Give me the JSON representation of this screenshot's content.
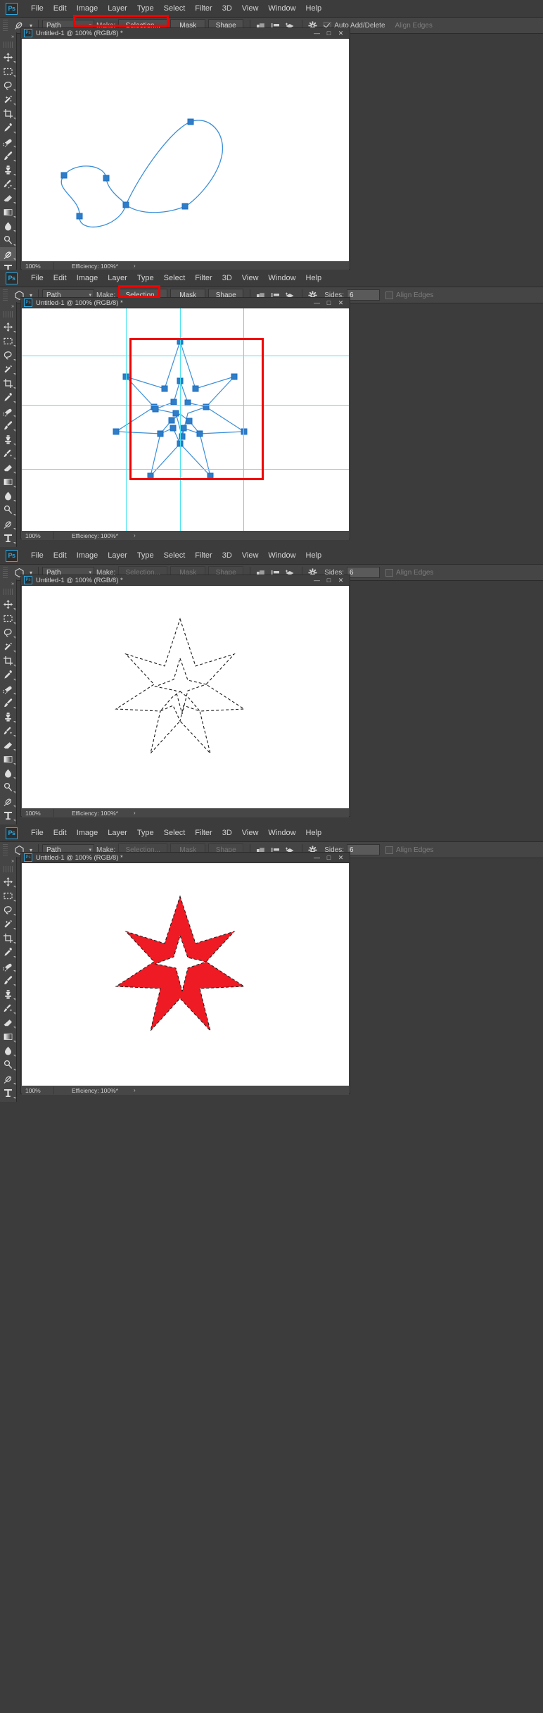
{
  "app": {
    "logo": "Ps",
    "menu": [
      "File",
      "Edit",
      "Image",
      "Layer",
      "Type",
      "Select",
      "Filter",
      "3D",
      "View",
      "Window",
      "Help"
    ]
  },
  "options_bar": {
    "mode_value": "Path",
    "make_label": "Make:",
    "selection_label": "Selection...",
    "mask_label": "Mask",
    "shape_label": "Shape",
    "sides_label": "Sides:",
    "sides_value": "6",
    "align_edges_label": "Align Edges",
    "auto_add_delete_label": "Auto Add/Delete",
    "icons": [
      "path-operations-icon",
      "path-alignment-icon",
      "path-arrangement-icon",
      "gear-icon"
    ]
  },
  "document": {
    "title": "Untitled-1 @ 100% (RGB/8) *",
    "window_buttons": [
      "minimize",
      "maximize",
      "close"
    ],
    "zoom": "100%",
    "efficiency": "Efficiency: 100%*",
    "status_arrow": "›"
  },
  "toolbar": {
    "collapse": "»",
    "tools": [
      {
        "name": "move-tool",
        "icon": "move"
      },
      {
        "name": "rectangular-marquee-tool",
        "icon": "marquee"
      },
      {
        "name": "lasso-tool",
        "icon": "lasso"
      },
      {
        "name": "quick-selection-tool",
        "icon": "wand"
      },
      {
        "name": "crop-tool",
        "icon": "crop"
      },
      {
        "name": "eyedropper-tool",
        "icon": "eyedropper"
      },
      {
        "name": "healing-brush-tool",
        "icon": "healing"
      },
      {
        "name": "brush-tool",
        "icon": "brush"
      },
      {
        "name": "clone-stamp-tool",
        "icon": "stamp"
      },
      {
        "name": "history-brush-tool",
        "icon": "historybrush"
      },
      {
        "name": "eraser-tool",
        "icon": "eraser"
      },
      {
        "name": "gradient-tool",
        "icon": "gradient"
      },
      {
        "name": "blur-tool",
        "icon": "blur"
      },
      {
        "name": "dodge-tool",
        "icon": "dodge"
      },
      {
        "name": "pen-tool",
        "icon": "pen"
      },
      {
        "name": "type-tool",
        "icon": "type"
      },
      {
        "name": "path-selection-tool",
        "icon": "pathselect"
      },
      {
        "name": "rectangle-tool",
        "icon": "shape"
      },
      {
        "name": "hand-tool",
        "icon": "hand"
      },
      {
        "name": "zoom-tool",
        "icon": "zoom"
      }
    ]
  },
  "panels": [
    {
      "id": "panel-1-pen-path",
      "tool": "pen-tool",
      "make_enabled": true,
      "shows_sides": false,
      "shows_auto_add_delete": true,
      "highlight": "make-group",
      "canvas_content": "bezier-heart-path",
      "title": "Untitled-1 @ 100% (RGB/8) *"
    },
    {
      "id": "panel-2-polygon-path-selected",
      "tool": "polygon-tool",
      "make_enabled": true,
      "shows_sides": true,
      "shows_auto_add_delete": false,
      "highlight": "selection-button",
      "canvas_content": "star-path-with-anchors",
      "title": "Untitled-1 @ 100% (RGB/8) *"
    },
    {
      "id": "panel-3-marching-ants",
      "tool": "polygon-tool",
      "make_enabled": false,
      "shows_sides": true,
      "shows_auto_add_delete": false,
      "highlight": "none",
      "canvas_content": "star-marching-ants",
      "title": "Untitled-1 @ 100% (RGB/8) *"
    },
    {
      "id": "panel-4-filled-red-star",
      "tool": "polygon-tool",
      "make_enabled": false,
      "shows_sides": true,
      "shows_auto_add_delete": false,
      "highlight": "none",
      "canvas_content": "star-filled-red",
      "title": "Untitled-1 @ 100% (RGB/8) *"
    }
  ],
  "colors": {
    "chrome": "#3c3c3c",
    "options_bar": "#454545",
    "canvas": "#ffffff",
    "path_blue": "#3b8fd8",
    "anchor_blue": "#1a6fc4",
    "annotation_red": "#f10000",
    "fill_red": "#ee1b24",
    "guide_cyan": "#4de3ef",
    "accent": "#2ea8e0"
  }
}
